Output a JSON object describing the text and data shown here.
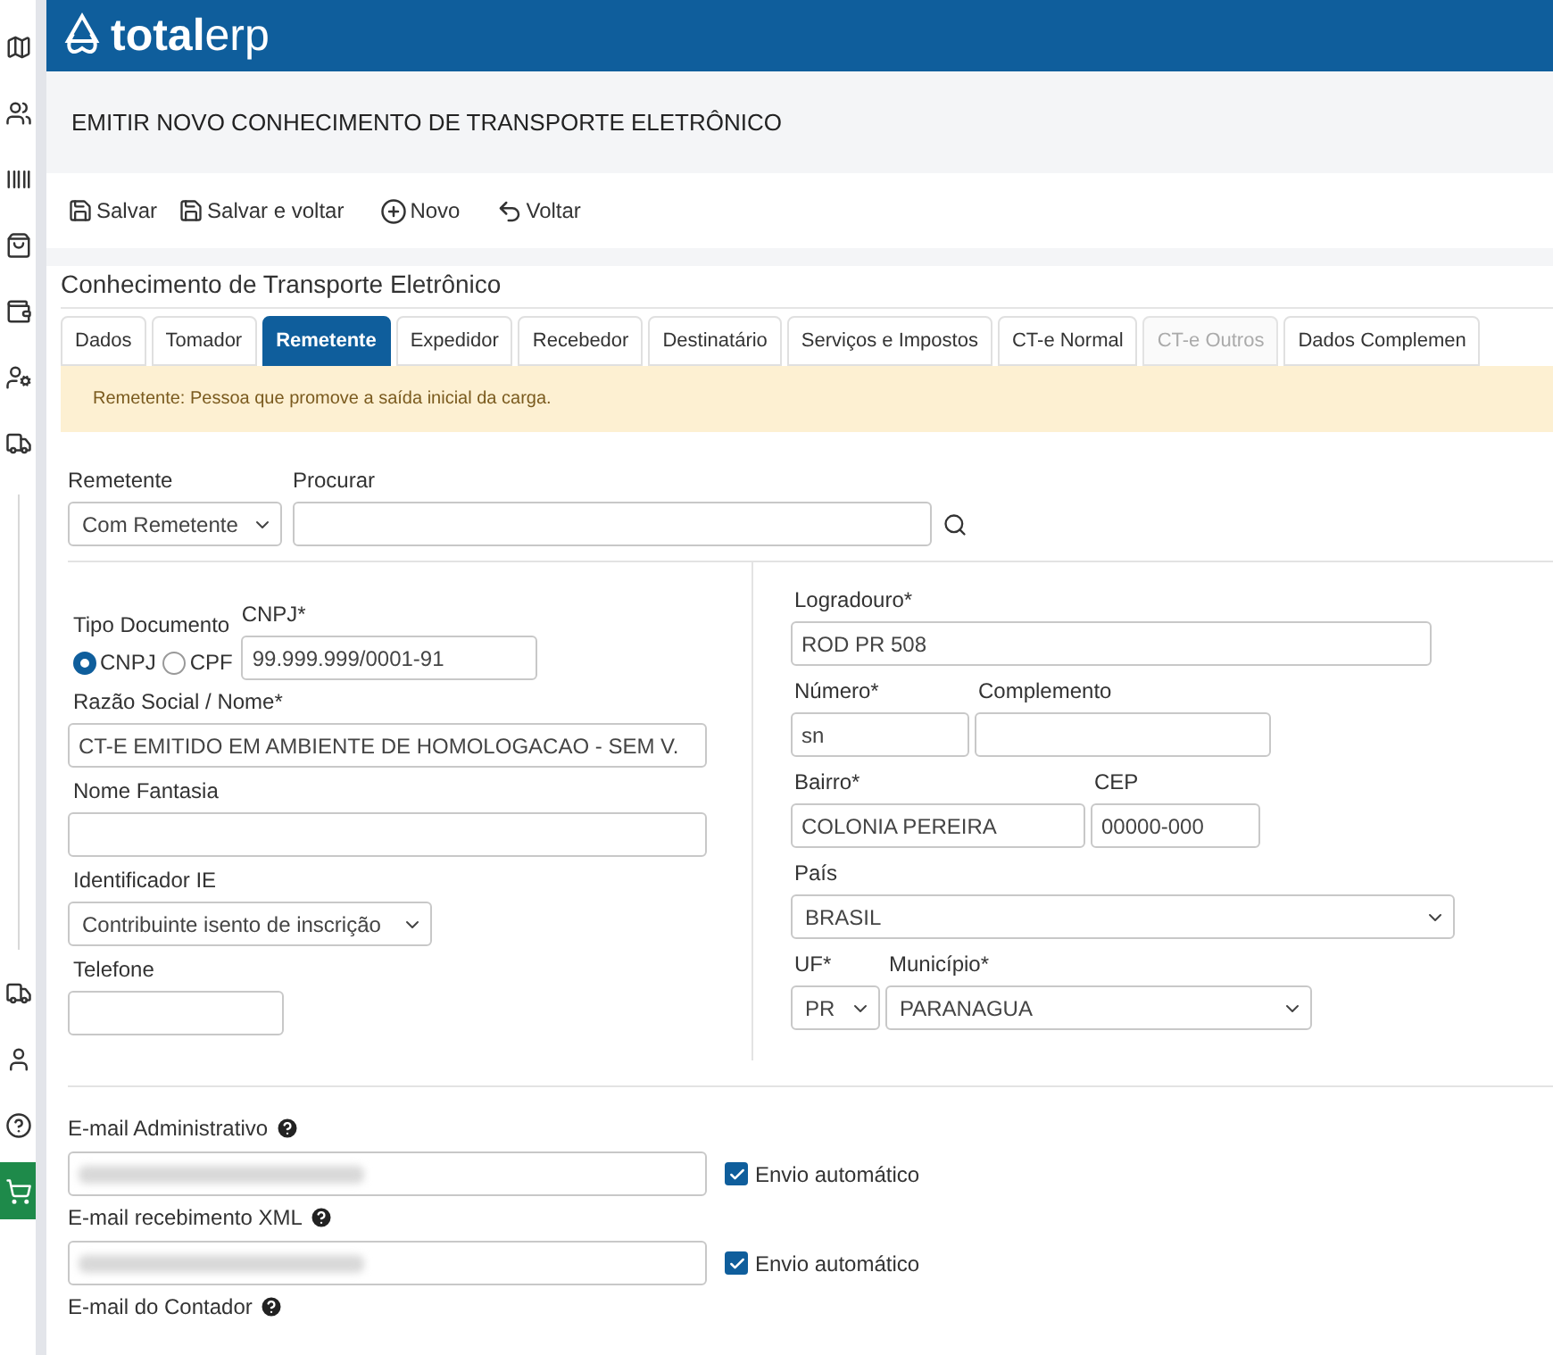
{
  "sidebar": {
    "items": [
      {
        "selected": false
      },
      {
        "selected": false
      },
      {
        "selected": false
      },
      {
        "selected": false
      },
      {
        "selected": false
      },
      {
        "selected": false
      },
      {
        "selected": false
      },
      {
        "selected": false
      },
      {
        "selected": false
      },
      {
        "selected": false
      },
      {
        "selected": true
      }
    ]
  },
  "header": {
    "logo_bold": "total",
    "logo_light": "erp"
  },
  "page_title": "EMITIR NOVO CONHECIMENTO DE TRANSPORTE ELETRÔNICO",
  "toolbar": [
    {
      "kind": "save",
      "label": "Salvar"
    },
    {
      "kind": "save",
      "label": "Salvar e voltar"
    },
    {
      "kind": "new",
      "label": "Novo"
    },
    {
      "kind": "back",
      "label": "Voltar"
    }
  ],
  "panel_title": "Conhecimento de Transporte Eletrônico",
  "tabs": [
    {
      "label": "Dados",
      "selected": false,
      "disabled": false
    },
    {
      "label": "Tomador",
      "selected": false,
      "disabled": false
    },
    {
      "label": "Remetente",
      "selected": true,
      "disabled": false
    },
    {
      "label": "Expedidor",
      "selected": false,
      "disabled": false
    },
    {
      "label": "Recebedor",
      "selected": false,
      "disabled": false
    },
    {
      "label": "Destinatário",
      "selected": false,
      "disabled": false
    },
    {
      "label": "Serviços e Impostos",
      "selected": false,
      "disabled": false
    },
    {
      "label": "CT-e Normal",
      "selected": false,
      "disabled": false
    },
    {
      "label": "CT-e Outros",
      "selected": false,
      "disabled": true
    },
    {
      "label": "Dados Complemen",
      "selected": false,
      "disabled": false
    }
  ],
  "alert": "Remetente: Pessoa que promove a saída inicial da carga.",
  "remetente": {
    "label": "Remetente",
    "value": "Com Remetente"
  },
  "procurar": {
    "label": "Procurar"
  },
  "tipo_documento": {
    "label": "Tipo Documento",
    "options": [
      {
        "label": "CNPJ",
        "selected": true
      },
      {
        "label": "CPF",
        "selected": false
      }
    ]
  },
  "cnpj": {
    "label": "CNPJ*",
    "value": "99.999.999/0001-91"
  },
  "razao_social": {
    "label": "Razão Social / Nome*",
    "value": "CT-E EMITIDO EM AMBIENTE DE HOMOLOGACAO - SEM V."
  },
  "nome_fantasia": {
    "label": "Nome Fantasia"
  },
  "identificador_ie": {
    "label": "Identificador IE",
    "value": "Contribuinte isento de inscrição"
  },
  "telefone": {
    "label": "Telefone"
  },
  "logradouro": {
    "label": "Logradouro*",
    "value": "ROD PR 508"
  },
  "numero": {
    "label": "Número*",
    "value": "sn"
  },
  "complemento": {
    "label": "Complemento"
  },
  "bairro": {
    "label": "Bairro*",
    "value": "COLONIA PEREIRA"
  },
  "cep": {
    "label": "CEP",
    "value": "00000-000"
  },
  "pais": {
    "label": "País",
    "value": "BRASIL"
  },
  "uf": {
    "label": "UF*",
    "value": "PR"
  },
  "municipio": {
    "label": "Município*",
    "value": "PARANAGUA"
  },
  "emails": [
    {
      "label": "E-mail Administrativo",
      "checkbox": {
        "label": "Envio automático",
        "checked": true
      }
    },
    {
      "label": "E-mail recebimento XML",
      "checkbox": {
        "label": "Envio automático",
        "checked": true
      }
    },
    {
      "label": "E-mail do Contador"
    }
  ]
}
